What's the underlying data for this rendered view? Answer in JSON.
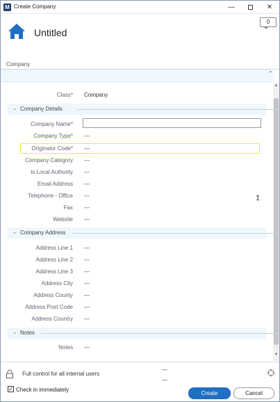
{
  "window": {
    "title": "Create Company",
    "app_icon": "M"
  },
  "header": {
    "title": "Untitled",
    "comment_count": "0"
  },
  "top_section_label": "Company",
  "class_field": {
    "label": "Class*",
    "value": "Company"
  },
  "company_details": {
    "title": "Company Details",
    "fields": [
      {
        "label": "Company Name*",
        "value": ""
      },
      {
        "label": "Company Type*",
        "value": "---"
      },
      {
        "label": "Originator Code*",
        "value": "---"
      },
      {
        "label": "Company Category",
        "value": "---"
      },
      {
        "label": "Is Local Authority",
        "value": "---"
      },
      {
        "label": "Email Address",
        "value": "---"
      },
      {
        "label": "Telephone - Office",
        "value": "---"
      },
      {
        "label": "Fax",
        "value": "---"
      },
      {
        "label": "Website",
        "value": "---"
      }
    ]
  },
  "company_address": {
    "title": "Company Address",
    "fields": [
      {
        "label": "Address Line 1",
        "value": "---"
      },
      {
        "label": "Address Line 2",
        "value": "---"
      },
      {
        "label": "Address Line 3",
        "value": "---"
      },
      {
        "label": "Address City",
        "value": "---"
      },
      {
        "label": "Address County",
        "value": "---"
      },
      {
        "label": "Address Post Code",
        "value": "---"
      },
      {
        "label": "Address Country",
        "value": "---"
      }
    ]
  },
  "notes": {
    "title": "Notes",
    "fields": [
      {
        "label": "Notes",
        "value": "---"
      }
    ]
  },
  "footer": {
    "permission": "Full control for all internal users",
    "value1": "---",
    "value2": "---",
    "check_in_label": "Check in immediately",
    "check_in_checked": "✓",
    "create_label": "Create",
    "cancel_label": "Cancel"
  },
  "colors": {
    "accent": "#1f6fc2",
    "home_icon": "#1f6fc2",
    "highlight": "#e8e84a",
    "section_bg": "#eef7fb"
  }
}
